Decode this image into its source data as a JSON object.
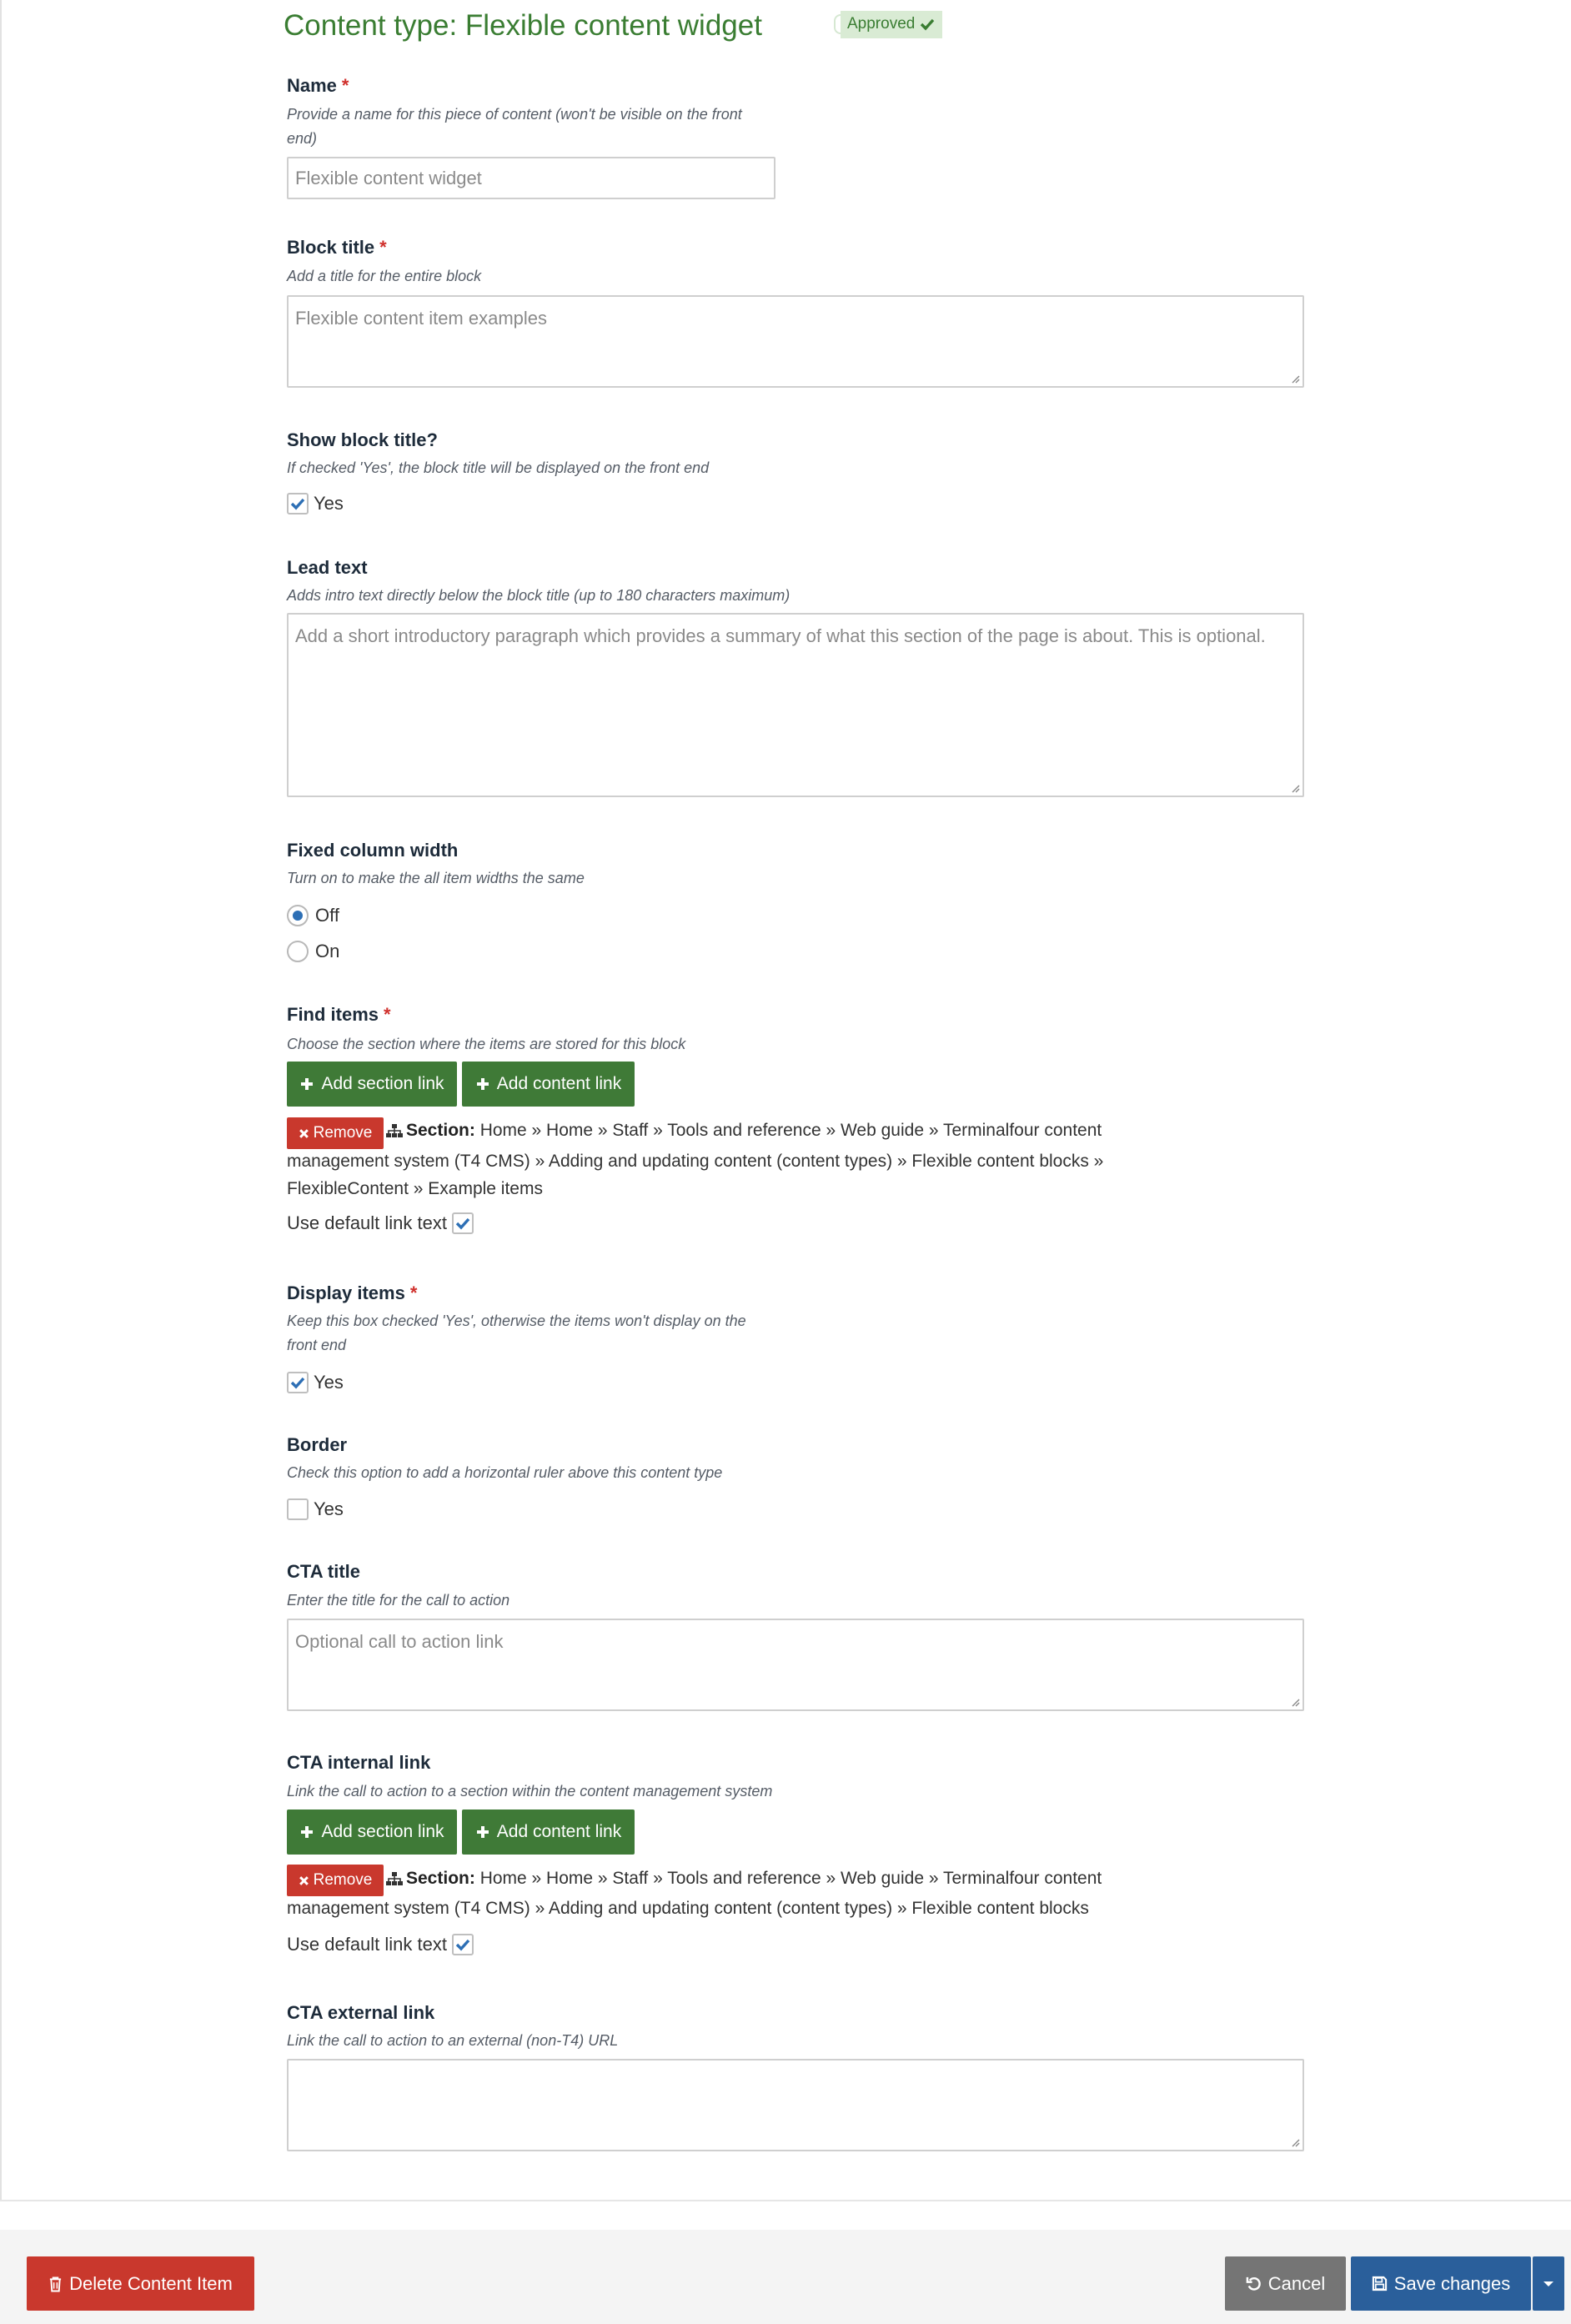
{
  "header": {
    "title": "Content type: Flexible content widget",
    "status_badge": "Approved"
  },
  "fields": {
    "name": {
      "label": "Name",
      "required_mark": "*",
      "help_line1": "Provide a name for this piece of content (won't be visible on the front",
      "help_line2": "end)",
      "value": "Flexible content widget"
    },
    "block_title": {
      "label": "Block title",
      "required_mark": "*",
      "help": "Add a title for the entire block",
      "value": "Flexible content item examples"
    },
    "show_block_title": {
      "label": "Show block title?",
      "help": "If checked 'Yes', the block title will be displayed on the front end",
      "option": "Yes",
      "checked": true
    },
    "lead_text": {
      "label": "Lead text",
      "help": "Adds intro text directly below the block title (up to 180 characters maximum)",
      "value": "Add a short introductory paragraph which provides a summary of what this section of the page is about. This is optional."
    },
    "fixed_column_width": {
      "label": "Fixed column width",
      "help": "Turn on to make the all item widths the same",
      "options": [
        "Off",
        "On"
      ],
      "selected": "Off"
    },
    "find_items": {
      "label": "Find items",
      "required_mark": "*",
      "help": "Choose the section where the items are stored for this block",
      "add_section_label": "Add section link",
      "add_content_label": "Add content link",
      "remove_label": "Remove",
      "section_prefix": "Section:",
      "section_line1": "Home » Home » Staff » Tools and reference » Web guide » Terminalfour content",
      "section_line2": "management system (T4 CMS) » Adding and updating content (content types) » Flexible content blocks »",
      "section_line3": "FlexibleContent » Example items",
      "default_link_label": "Use default link text",
      "default_link_checked": true
    },
    "display_items": {
      "label": "Display items",
      "required_mark": "*",
      "help_line1": "Keep this box checked 'Yes', otherwise the items won't display on the",
      "help_line2": "front end",
      "option": "Yes",
      "checked": true
    },
    "border": {
      "label": "Border",
      "help": "Check this option to add a horizontal ruler above this content type",
      "option": "Yes",
      "checked": false
    },
    "cta_title": {
      "label": "CTA title",
      "help": "Enter the title for the call to action",
      "value": "Optional call to action link"
    },
    "cta_internal_link": {
      "label": "CTA internal link",
      "help": "Link the call to action to a section within the content management system",
      "add_section_label": "Add section link",
      "add_content_label": "Add content link",
      "remove_label": "Remove",
      "section_prefix": "Section:",
      "section_line1": "Home » Home » Staff » Tools and reference » Web guide » Terminalfour content",
      "section_line2": "management system (T4 CMS) » Adding and updating content (content types) » Flexible content blocks",
      "default_link_label": "Use default link text",
      "default_link_checked": true
    },
    "cta_external_link": {
      "label": "CTA external link",
      "help": "Link the call to action to an external (non-T4) URL",
      "value": ""
    }
  },
  "footer": {
    "delete_label": "Delete Content Item",
    "cancel_label": "Cancel",
    "save_label": "Save changes"
  },
  "colors": {
    "title_green": "#3a7d32",
    "button_green": "#3f7a37",
    "danger_red": "#c9382d",
    "primary_blue": "#2a5f9b",
    "cancel_grey": "#757575",
    "required_red": "#d0312d"
  },
  "icons": [
    "check-icon",
    "plus-icon",
    "times-icon",
    "sitemap-icon",
    "trash-icon",
    "undo-icon",
    "save-icon",
    "caret-down-icon",
    "resize-grip-icon"
  ]
}
